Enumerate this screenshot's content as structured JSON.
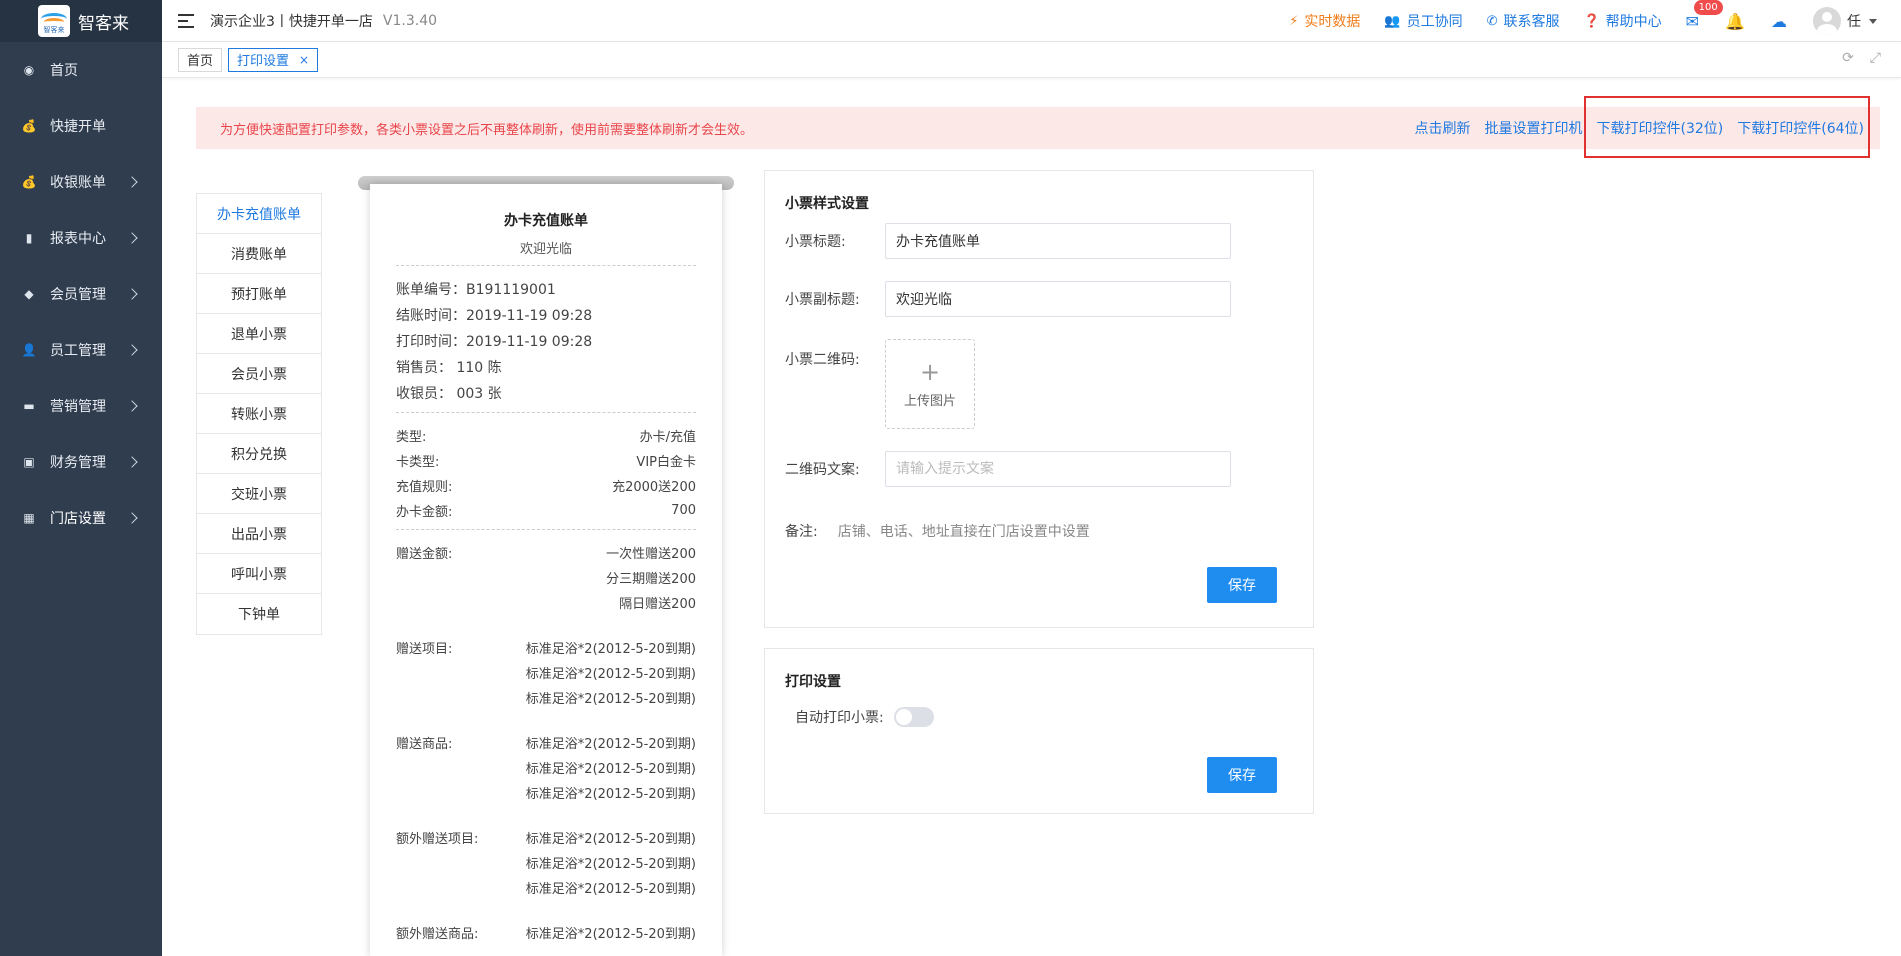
{
  "sidebar": {
    "logo_text": "智客来",
    "logo_mark_text": "智客来",
    "items": [
      {
        "label": "首页",
        "icon": "dashboard-icon",
        "has_arrow": false
      },
      {
        "label": "快捷开单",
        "icon": "money-bag-icon",
        "has_arrow": false
      },
      {
        "label": "收银账单",
        "icon": "money-bag-icon",
        "has_arrow": true
      },
      {
        "label": "报表中心",
        "icon": "bar-chart-icon",
        "has_arrow": true
      },
      {
        "label": "会员管理",
        "icon": "diamond-icon",
        "has_arrow": true
      },
      {
        "label": "员工管理",
        "icon": "user-icon",
        "has_arrow": true
      },
      {
        "label": "营销管理",
        "icon": "briefcase-icon",
        "has_arrow": true
      },
      {
        "label": "财务管理",
        "icon": "wallet-icon",
        "has_arrow": true
      },
      {
        "label": "门店设置",
        "icon": "grid-icon",
        "has_arrow": true
      }
    ]
  },
  "header": {
    "company": "演示企业3丨快捷开单一店",
    "version": "V1.3.40",
    "links": {
      "realtime": "实时数据",
      "staff": "员工协同",
      "support": "联系客服",
      "help": "帮助中心"
    },
    "mail_badge": "100",
    "user_name": "任"
  },
  "tabs": {
    "home": "首页",
    "active": "打印设置",
    "close": "×"
  },
  "notice": {
    "text": "为方便快速配置打印参数，各类小票设置之后不再整体刷新，使用前需要整体刷新才会生效。",
    "refresh": "点击刷新",
    "batch": "批量设置打印机",
    "download32": "下载打印控件(32位)",
    "download64": "下载打印控件(64位)"
  },
  "ticket_types": [
    "办卡充值账单",
    "消费账单",
    "预打账单",
    "退单小票",
    "会员小票",
    "转账小票",
    "积分兑换",
    "交班小票",
    "出品小票",
    "呼叫小票",
    "下钟单"
  ],
  "receipt": {
    "title": "办卡充值账单",
    "subtitle": "欢迎光临",
    "info": [
      "账单编号：B191119001",
      "结账时间：2019-11-19 09:28",
      "打印时间：2019-11-19 09:28",
      "销售员： 110 陈",
      "收银员： 003 张"
    ],
    "details": [
      {
        "label": "类型:",
        "value": "办卡/充值"
      },
      {
        "label": "卡类型:",
        "value": "VIP白金卡"
      },
      {
        "label": "充值规则:",
        "value": "充2000送200"
      },
      {
        "label": "办卡金额:",
        "value": "700"
      }
    ],
    "groups": [
      {
        "label": "赠送金额:",
        "values": [
          "一次性赠送200",
          "分三期赠送200",
          "隔日赠送200"
        ]
      },
      {
        "label": "赠送项目:",
        "values": [
          "标准足浴*2(2012-5-20到期)",
          "标准足浴*2(2012-5-20到期)",
          "标准足浴*2(2012-5-20到期)"
        ]
      },
      {
        "label": "赠送商品:",
        "values": [
          "标准足浴*2(2012-5-20到期)",
          "标准足浴*2(2012-5-20到期)",
          "标准足浴*2(2012-5-20到期)"
        ]
      },
      {
        "label": "额外赠送项目:",
        "values": [
          "标准足浴*2(2012-5-20到期)",
          "标准足浴*2(2012-5-20到期)",
          "标准足浴*2(2012-5-20到期)"
        ]
      },
      {
        "label": "额外赠送商品:",
        "values": [
          "标准足浴*2(2012-5-20到期)"
        ]
      }
    ]
  },
  "style_settings": {
    "title": "小票样式设置",
    "ticket_title_label": "小票标题:",
    "ticket_title_value": "办卡充值账单",
    "ticket_subtitle_label": "小票副标题:",
    "ticket_subtitle_value": "欢迎光临",
    "qr_label": "小票二维码:",
    "upload_label": "上传图片",
    "qr_text_label": "二维码文案:",
    "qr_text_placeholder": "请输入提示文案",
    "note_label": "备注:",
    "note_value": "店铺、电话、地址直接在门店设置中设置",
    "save": "保存"
  },
  "print_settings": {
    "title": "打印设置",
    "auto_print_label": "自动打印小票:",
    "auto_print": false,
    "save": "保存"
  },
  "colors": {
    "sidebar_bg": "#2f3d4f",
    "accent": "#1f7ae0",
    "notice_bg": "#fde8e8",
    "notice_text": "#e8454a",
    "highlight": "#e0302f"
  }
}
